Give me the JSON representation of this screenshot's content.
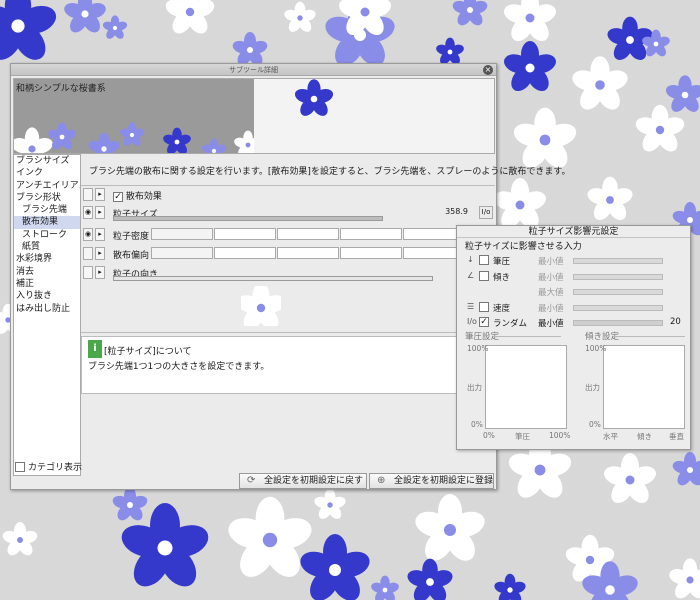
{
  "dialog": {
    "title": "サブツール詳細",
    "preview_label": "和柄シンプルな桜書系",
    "categories": [
      {
        "label": "ブラシサイズ",
        "sub": false,
        "active": false
      },
      {
        "label": "インク",
        "sub": false,
        "active": false
      },
      {
        "label": "アンチエイリアス",
        "sub": false,
        "active": false
      },
      {
        "label": "ブラシ形状",
        "sub": false,
        "active": false
      },
      {
        "label": "ブラシ先端",
        "sub": true,
        "active": false
      },
      {
        "label": "散布効果",
        "sub": true,
        "active": true
      },
      {
        "label": "ストローク",
        "sub": true,
        "active": false
      },
      {
        "label": "紙質",
        "sub": true,
        "active": false
      },
      {
        "label": "水彩境界",
        "sub": false,
        "active": false
      },
      {
        "label": "消去",
        "sub": false,
        "active": false
      },
      {
        "label": "補正",
        "sub": false,
        "active": false
      },
      {
        "label": "入り抜き",
        "sub": false,
        "active": false
      },
      {
        "label": "はみ出し防止",
        "sub": false,
        "active": false
      }
    ],
    "category_show_label": "カテゴリ表示",
    "description": "ブラシ先端の散布に関する設定を行います。[散布効果]を設定すると、ブラシ先端を、スプレーのように散布できます。",
    "settings": {
      "scatter_label": "散布効果",
      "scatter_checked": true,
      "particle_size_label": "粒子サイズ",
      "particle_size_value": "358.9",
      "unit_icon": "I/o",
      "density_label": "粒子密度",
      "bias_label": "散布偏向",
      "direction_label": "粒子の向き"
    },
    "info": {
      "icon": "i",
      "title": "[粒子サイズ]について",
      "text": "ブラシ先端1つ1つの大きさを設定できます。"
    },
    "reset_button": "全設定を初期設定に戻す",
    "register_button": "全設定を初期設定に登録"
  },
  "influence": {
    "title": "粒子サイズ影響元設定",
    "subtitle": "粒子サイズに影響させる入力",
    "rows": [
      {
        "icon": "↓",
        "name": "筆圧",
        "min_label": "最小値",
        "checked": false,
        "num": ""
      },
      {
        "icon": "∠",
        "name": "傾き",
        "min_label": "最小値",
        "checked": false,
        "num": ""
      },
      {
        "icon": "",
        "name": "",
        "min_label": "最大値",
        "checked": false,
        "num": ""
      },
      {
        "icon": "☰",
        "name": "速度",
        "min_label": "最小値",
        "checked": false,
        "num": ""
      },
      {
        "icon": "I/o",
        "name": "ランダム",
        "min_label": "最小値",
        "checked": true,
        "num": "20"
      }
    ],
    "pressure_group": {
      "title": "筆圧設定",
      "y_top": "100%",
      "y_mid": "出力",
      "y_bottom": "0%",
      "x_left": "0%",
      "x_mid": "筆圧",
      "x_right": "100%"
    },
    "tilt_group": {
      "title": "傾き設定",
      "y_top": "100%",
      "y_mid": "出力",
      "y_bottom": "0%",
      "x_left": "水平",
      "x_mid": "傾き",
      "x_right": "垂直"
    }
  },
  "colors": {
    "blue": "#3a3fd0",
    "periwinkle": "#7d7fe3",
    "white": "#ffffff"
  }
}
